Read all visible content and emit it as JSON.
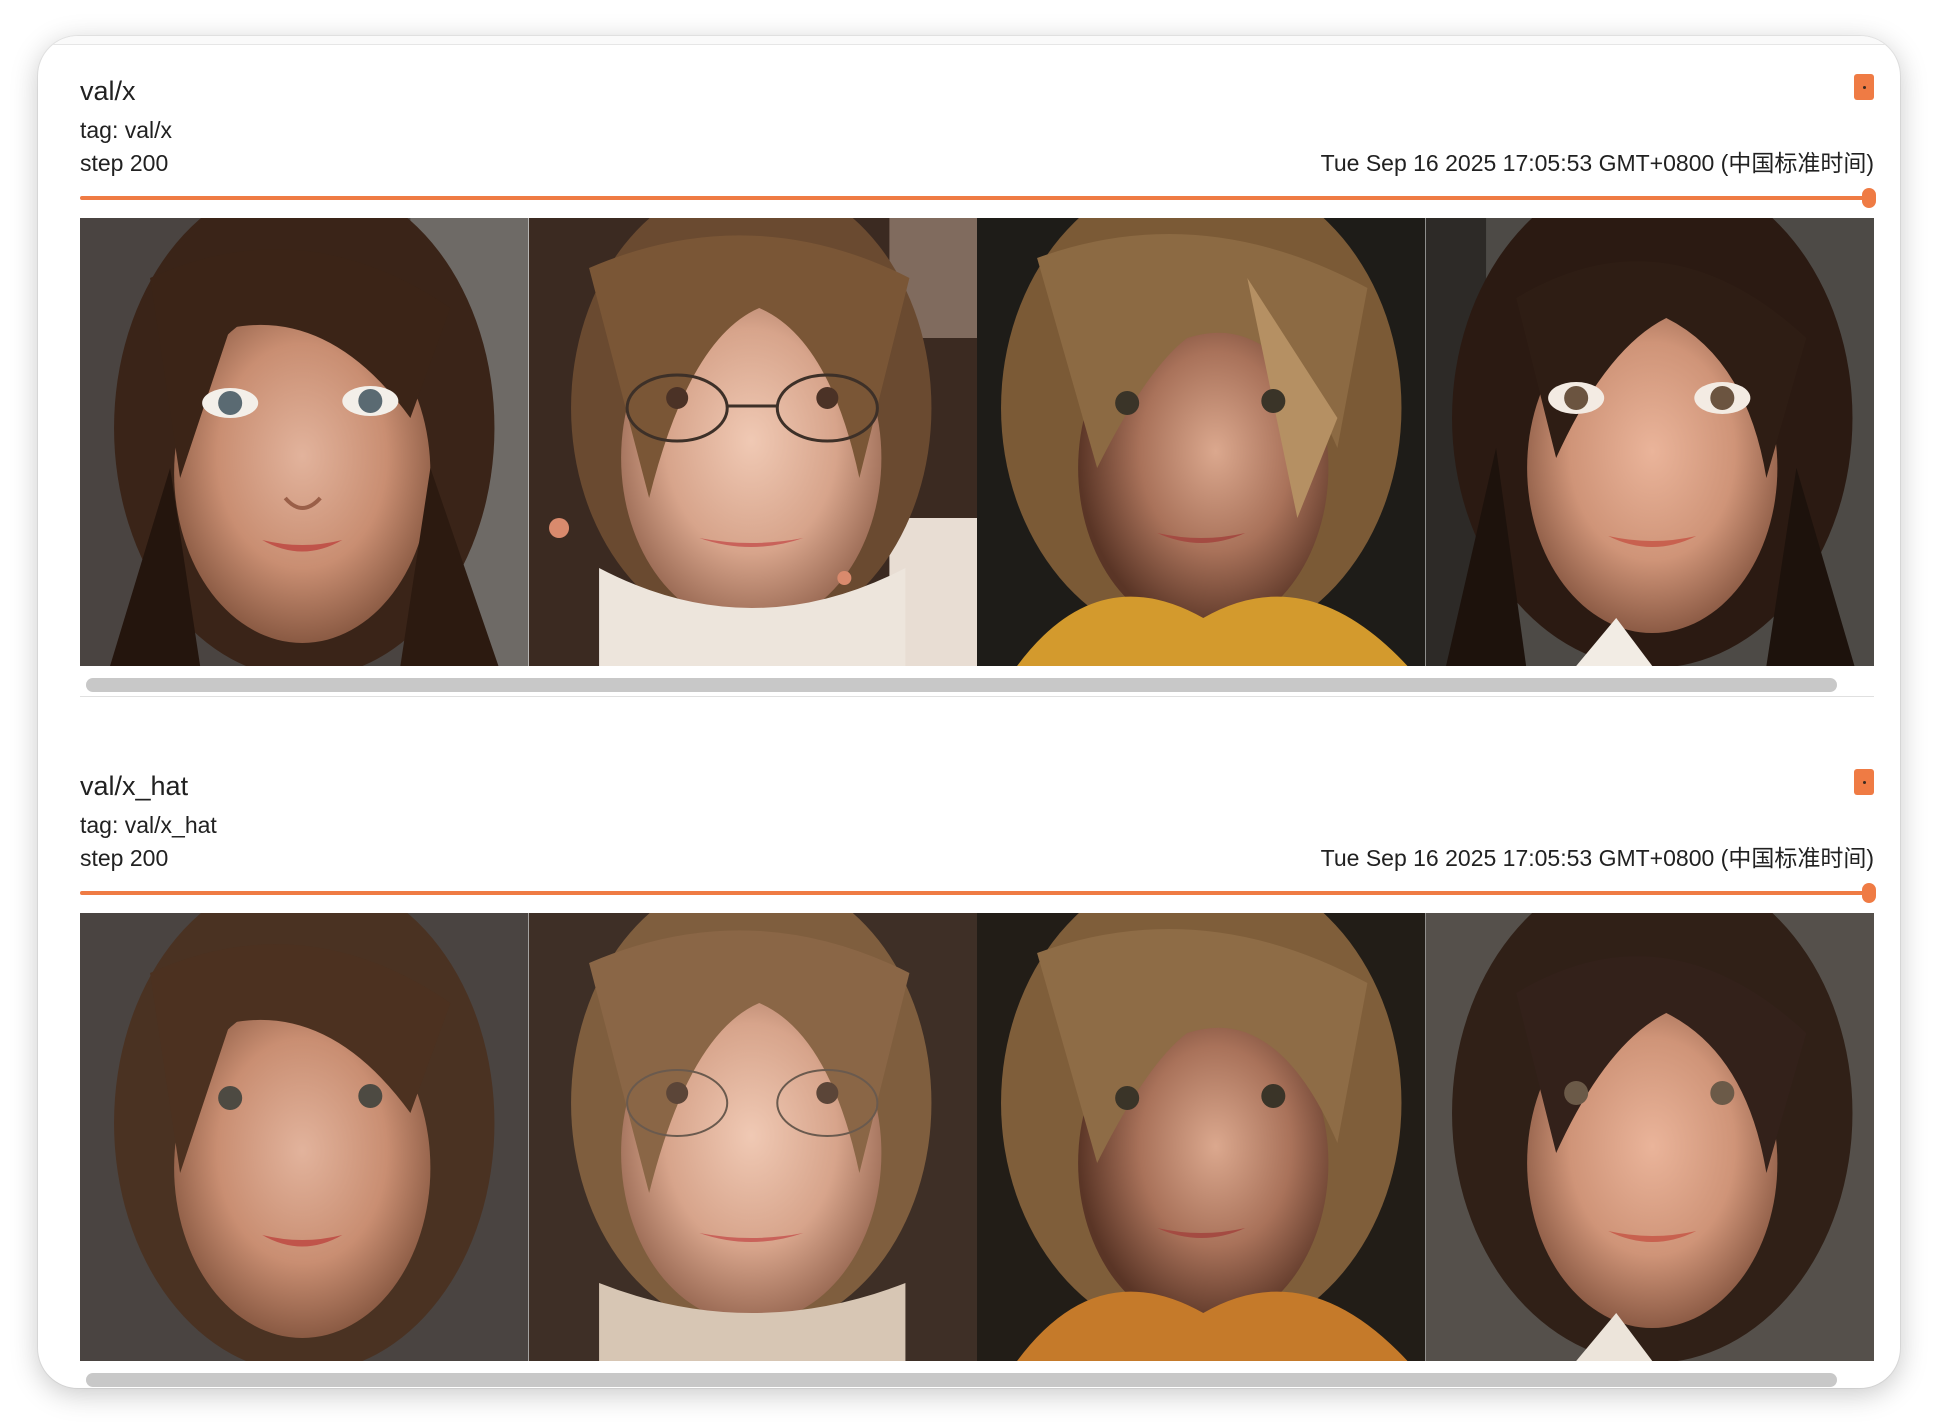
{
  "accent_color": "#ef7b44",
  "cards": [
    {
      "title": "val/x",
      "tag": "tag: val/x",
      "step": "step 200",
      "timestamp": "Tue Sep 16 2025 17:05:53 GMT+0800 (中国标准时间)",
      "slider_position": 1.0,
      "images": [
        {
          "subject": "portrait-dark-brown-hair"
        },
        {
          "subject": "portrait-glasses-earrings"
        },
        {
          "subject": "portrait-light-brown-hair-yellow-scarf"
        },
        {
          "subject": "portrait-long-dark-hair"
        }
      ]
    },
    {
      "title": "val/x_hat",
      "tag": "tag: val/x_hat",
      "step": "step 200",
      "timestamp": "Tue Sep 16 2025 17:05:53 GMT+0800 (中国标准时间)",
      "slider_position": 1.0,
      "images": [
        {
          "subject": "portrait-dark-brown-hair"
        },
        {
          "subject": "portrait-glasses"
        },
        {
          "subject": "portrait-light-brown-hair-orange-scarf"
        },
        {
          "subject": "portrait-long-dark-hair"
        }
      ]
    }
  ]
}
